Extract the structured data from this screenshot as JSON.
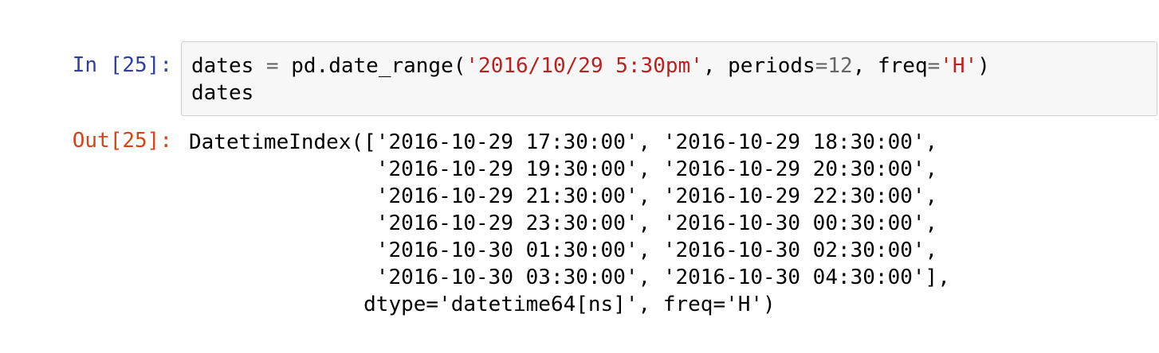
{
  "cell": {
    "in_prompt": "In [25]:",
    "out_prompt": "Out[25]:",
    "input": {
      "line1": {
        "var": "dates",
        "assign": " = ",
        "call": "pd.date_range(",
        "arg_date": "'2016/10/29 5:30pm'",
        "sep1": ", periods",
        "eq1": "=",
        "periods": "12",
        "sep2": ", freq",
        "eq2": "=",
        "freq": "'H'",
        "close": ")"
      },
      "line2": "dates"
    },
    "output_lines": [
      "DatetimeIndex(['2016-10-29 17:30:00', '2016-10-29 18:30:00',",
      "               '2016-10-29 19:30:00', '2016-10-29 20:30:00',",
      "               '2016-10-29 21:30:00', '2016-10-29 22:30:00',",
      "               '2016-10-29 23:30:00', '2016-10-30 00:30:00',",
      "               '2016-10-30 01:30:00', '2016-10-30 02:30:00',",
      "               '2016-10-30 03:30:00', '2016-10-30 04:30:00'],",
      "              dtype='datetime64[ns]', freq='H')"
    ]
  },
  "colors": {
    "in_prompt": "#303f9f",
    "out_prompt": "#d84315",
    "string": "#ba2121",
    "operator": "#666666",
    "input_bg": "#f7f7f7",
    "input_border": "#cfcfcf"
  }
}
